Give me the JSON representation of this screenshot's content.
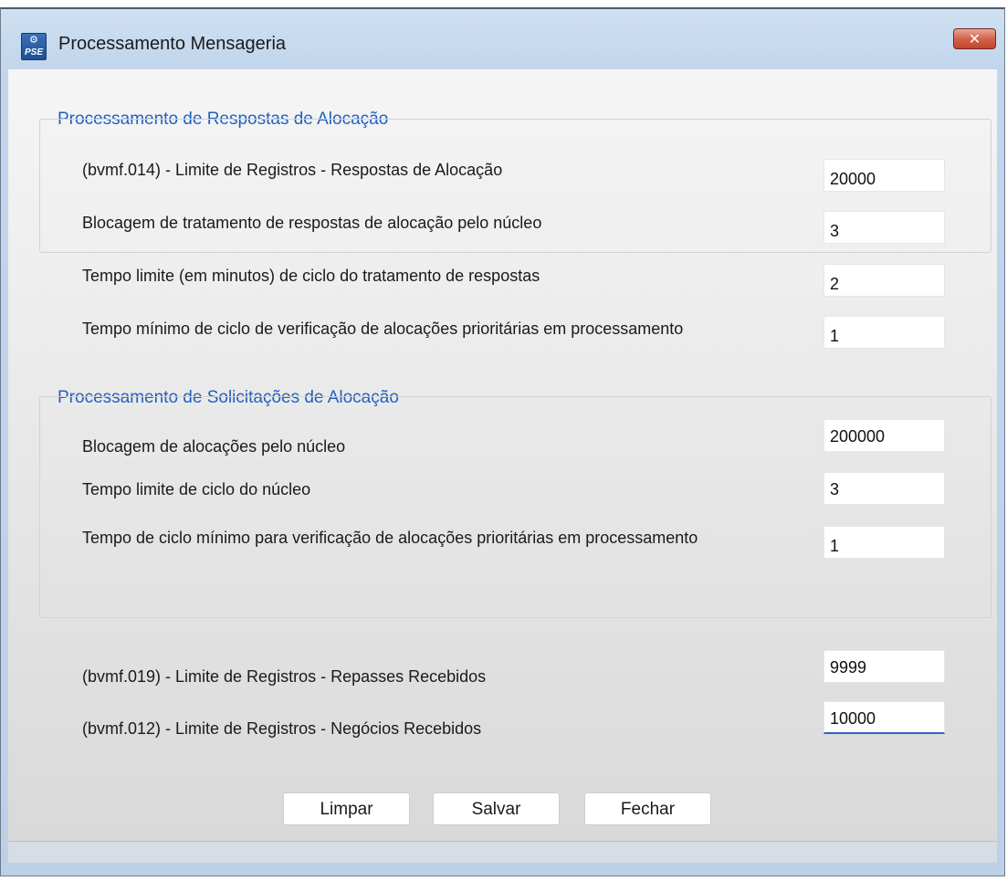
{
  "window": {
    "title": "Processamento Mensageria",
    "icon_text": "PSE",
    "close_glyph": "✕"
  },
  "respostas": {
    "title": "Processamento de Respostas de Alocação",
    "fields": [
      {
        "label": "(bvmf.014) - Limite de Registros - Respostas de Alocação",
        "value": "20000"
      },
      {
        "label": "Blocagem de tratamento de respostas de alocação pelo núcleo",
        "value": "3"
      },
      {
        "label": "Tempo limite (em minutos) de ciclo do tratamento de respostas",
        "value": "2"
      },
      {
        "label": "Tempo mínimo de ciclo de verificação de alocações prioritárias em processamento",
        "value": "1"
      }
    ]
  },
  "solicitacoes": {
    "title": "Processamento de Solicitações de Alocação",
    "fields": [
      {
        "label": "Blocagem de alocações pelo núcleo",
        "value": "200000"
      },
      {
        "label": "Tempo limite de ciclo do núcleo",
        "value": "3"
      },
      {
        "label": "Tempo de ciclo mínimo para verificação de alocações prioritárias em processamento",
        "value": "1"
      }
    ]
  },
  "outros": {
    "fields": [
      {
        "label": "(bvmf.019) - Limite de Registros - Repasses Recebidos",
        "value": "9999"
      },
      {
        "label": "(bvmf.012) - Limite de Registros - Negócios Recebidos",
        "value": "10000"
      }
    ]
  },
  "buttons": {
    "limpar": "Limpar",
    "salvar": "Salvar",
    "fechar": "Fechar"
  },
  "colors": {
    "section_title": "#1f5fbf",
    "close_button": "#c2452c",
    "focus_underline": "#2b68c5"
  },
  "icons": {
    "app": "pse-app-icon",
    "close": "close-icon"
  }
}
